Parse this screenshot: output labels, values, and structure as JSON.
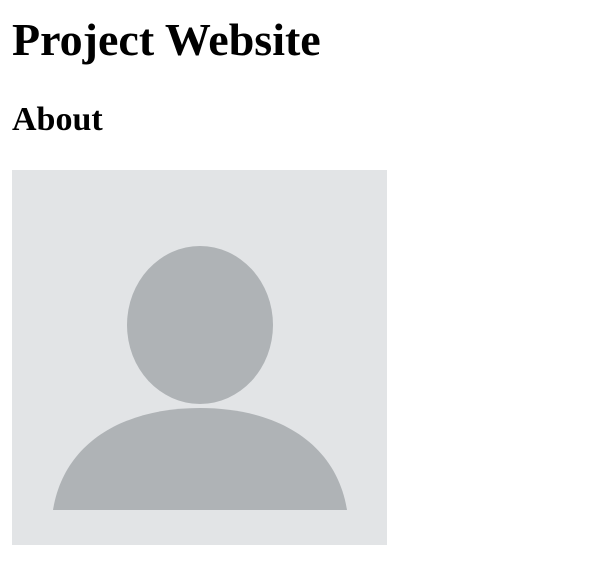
{
  "page": {
    "title": "Project Website",
    "section_heading": "About"
  },
  "avatar": {
    "icon": "default-user-avatar-icon",
    "background_color": "#e2e4e6",
    "figure_color": "#afb3b6"
  }
}
